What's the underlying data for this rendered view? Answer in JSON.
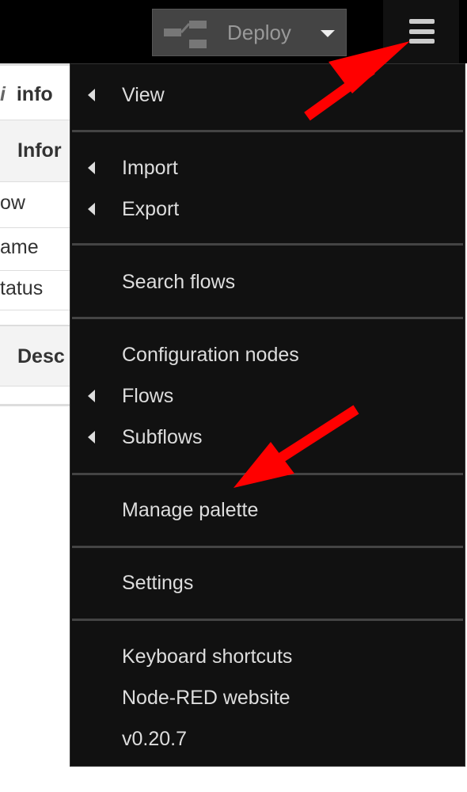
{
  "header": {
    "deploy_label": "Deploy",
    "menu_icon": "hamburger-icon"
  },
  "sidebar": {
    "tab_label": "info",
    "section_info": "Infor",
    "rows": [
      "ow",
      "ame",
      "tatus"
    ],
    "section_desc": "Desc"
  },
  "menu": {
    "view": "View",
    "import": "Import",
    "export": "Export",
    "search_flows": "Search flows",
    "configuration_nodes": "Configuration nodes",
    "flows": "Flows",
    "subflows": "Subflows",
    "manage_palette": "Manage palette",
    "settings": "Settings",
    "keyboard_shortcuts": "Keyboard shortcuts",
    "website": "Node-RED website",
    "version": "v0.20.7"
  },
  "annotations": {
    "arrow_color": "#ff0000"
  }
}
